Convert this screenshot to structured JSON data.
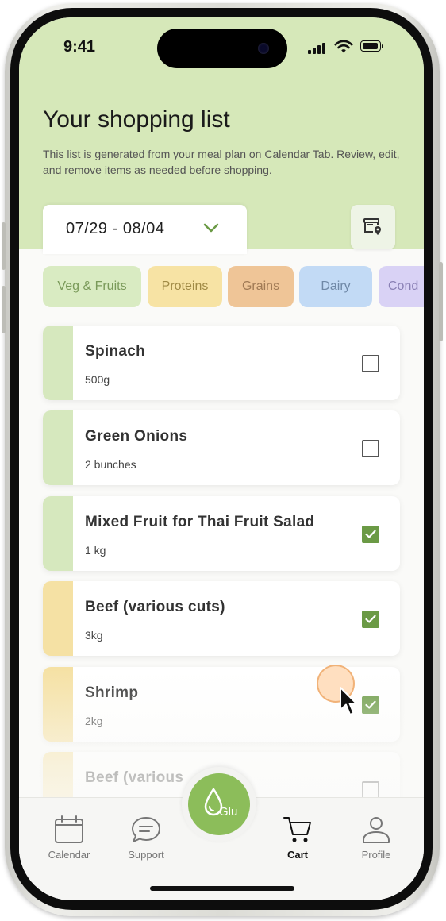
{
  "status_bar": {
    "time": "9:41"
  },
  "header": {
    "title": "Your shopping list",
    "description": "This list is generated from your meal plan on Calendar Tab. Review, edit, and remove items as needed before shopping."
  },
  "date_range": {
    "label": "07/29 - 08/04"
  },
  "categories": [
    {
      "label": "Veg & Fruits",
      "color": "#d9ebc2",
      "text_color": "#7a9a5a"
    },
    {
      "label": "Proteins",
      "color": "#f7e3a4",
      "text_color": "#a08a45"
    },
    {
      "label": "Grains",
      "color": "#efc597",
      "text_color": "#a07a55"
    },
    {
      "label": "Dairy",
      "color": "#c2daf5",
      "text_color": "#6f88a6"
    },
    {
      "label": "Cond",
      "color": "#d9d2f5",
      "text_color": "#8a80b5"
    }
  ],
  "items": [
    {
      "name": "Spinach",
      "qty": "500g",
      "checked": false,
      "stripe_color": "#d6e8be"
    },
    {
      "name": "Green Onions",
      "qty": "2 bunches",
      "checked": false,
      "stripe_color": "#d6e8be"
    },
    {
      "name": "Mixed Fruit for Thai Fruit Salad",
      "qty": "1 kg",
      "checked": true,
      "stripe_color": "#d6e8be"
    },
    {
      "name": "Beef (various cuts)",
      "qty": "3kg",
      "checked": true,
      "stripe_color": "#f5e1a4"
    },
    {
      "name": "Shrimp",
      "qty": "2kg",
      "checked": true,
      "stripe_color": "#f5e1a4"
    },
    {
      "name": "Beef (various",
      "qty": "",
      "checked": false,
      "stripe_color": "#f5e1a4"
    }
  ],
  "tab_bar": {
    "calendar_label": "Calendar",
    "support_label": "Support",
    "glu_label": "Glu",
    "cart_label": "Cart",
    "profile_label": "Profile",
    "active_tab": "Cart"
  },
  "colors": {
    "header_bg": "#d6e8b9",
    "accent_green": "#6b9a45",
    "glu_green": "#8cbd5a"
  }
}
